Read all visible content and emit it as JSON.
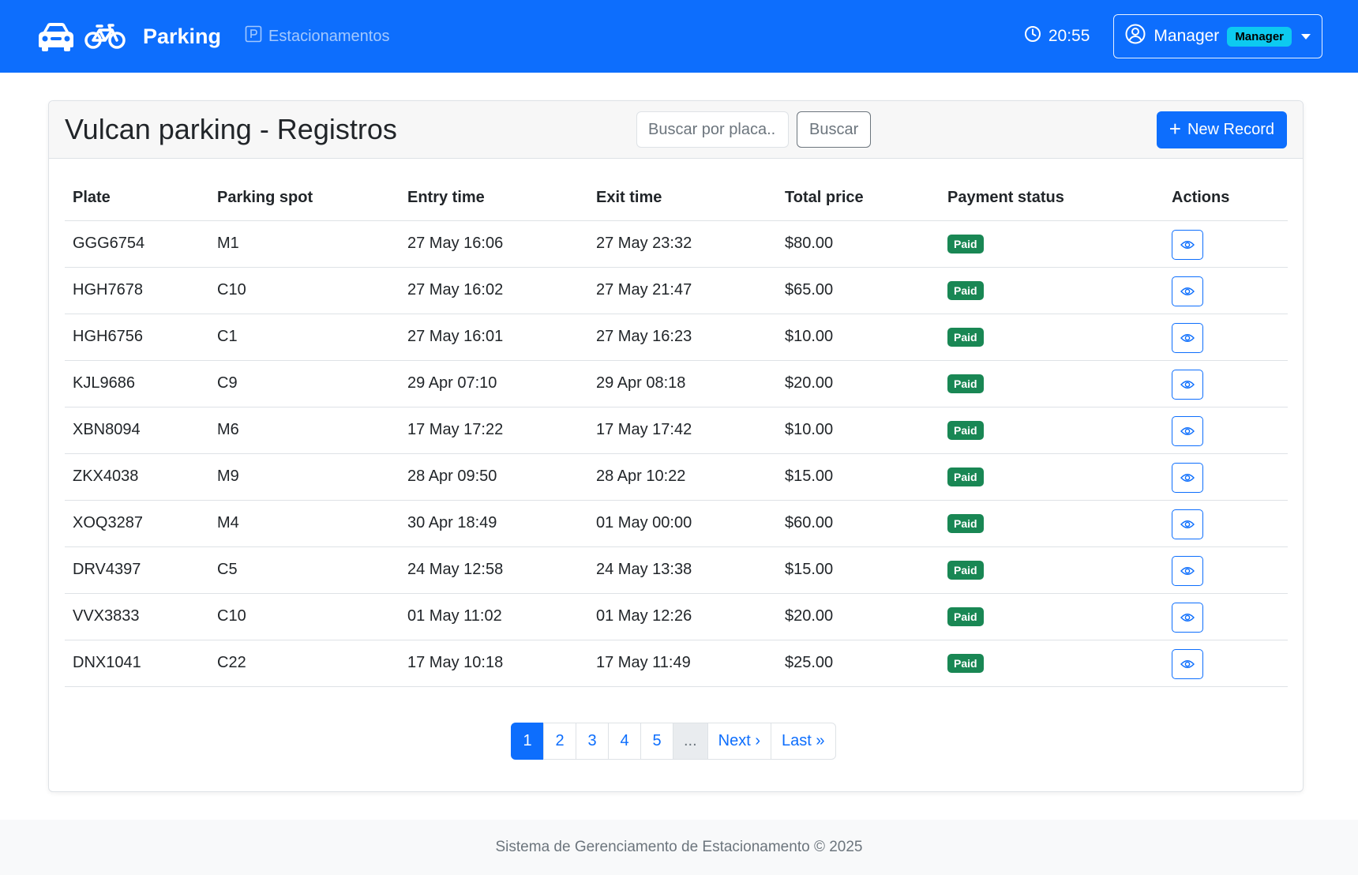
{
  "navbar": {
    "brand": "Parking",
    "nav_link": "Estacionamentos",
    "clock": "20:55",
    "user_name": "Manager",
    "role_badge": "Manager"
  },
  "card": {
    "title": "Vulcan parking - Registros",
    "search_placeholder": "Buscar por placa...",
    "search_button": "Buscar",
    "new_button": "New Record"
  },
  "table": {
    "headers": [
      "Plate",
      "Parking spot",
      "Entry time",
      "Exit time",
      "Total price",
      "Payment status",
      "Actions"
    ],
    "rows": [
      {
        "plate": "GGG6754",
        "spot": "M1",
        "entry": "27 May 16:06",
        "exit": "27 May 23:32",
        "price": "$80.00",
        "status": "Paid"
      },
      {
        "plate": "HGH7678",
        "spot": "C10",
        "entry": "27 May 16:02",
        "exit": "27 May 21:47",
        "price": "$65.00",
        "status": "Paid"
      },
      {
        "plate": "HGH6756",
        "spot": "C1",
        "entry": "27 May 16:01",
        "exit": "27 May 16:23",
        "price": "$10.00",
        "status": "Paid"
      },
      {
        "plate": "KJL9686",
        "spot": "C9",
        "entry": "29 Apr 07:10",
        "exit": "29 Apr 08:18",
        "price": "$20.00",
        "status": "Paid"
      },
      {
        "plate": "XBN8094",
        "spot": "M6",
        "entry": "17 May 17:22",
        "exit": "17 May 17:42",
        "price": "$10.00",
        "status": "Paid"
      },
      {
        "plate": "ZKX4038",
        "spot": "M9",
        "entry": "28 Apr 09:50",
        "exit": "28 Apr 10:22",
        "price": "$15.00",
        "status": "Paid"
      },
      {
        "plate": "XOQ3287",
        "spot": "M4",
        "entry": "30 Apr 18:49",
        "exit": "01 May 00:00",
        "price": "$60.00",
        "status": "Paid"
      },
      {
        "plate": "DRV4397",
        "spot": "C5",
        "entry": "24 May 12:58",
        "exit": "24 May 13:38",
        "price": "$15.00",
        "status": "Paid"
      },
      {
        "plate": "VVX3833",
        "spot": "C10",
        "entry": "01 May 11:02",
        "exit": "01 May 12:26",
        "price": "$20.00",
        "status": "Paid"
      },
      {
        "plate": "DNX1041",
        "spot": "C22",
        "entry": "17 May 10:18",
        "exit": "17 May 11:49",
        "price": "$25.00",
        "status": "Paid"
      }
    ]
  },
  "pagination": {
    "pages": [
      "1",
      "2",
      "3",
      "4",
      "5"
    ],
    "active": "1",
    "ellipsis": "...",
    "next": "Next ›",
    "last": "Last »"
  },
  "footer": {
    "text": "Sistema de Gerenciamento de Estacionamento © 2025"
  },
  "colors": {
    "primary": "#0d6efd",
    "success": "#198754",
    "info": "#0dcaf0"
  },
  "icons": {
    "brand_car": "car-icon",
    "brand_bike": "bicycle-icon",
    "nav_parking": "parking-sign-icon",
    "clock": "clock-icon",
    "user": "user-circle-icon",
    "view": "eye-icon"
  }
}
